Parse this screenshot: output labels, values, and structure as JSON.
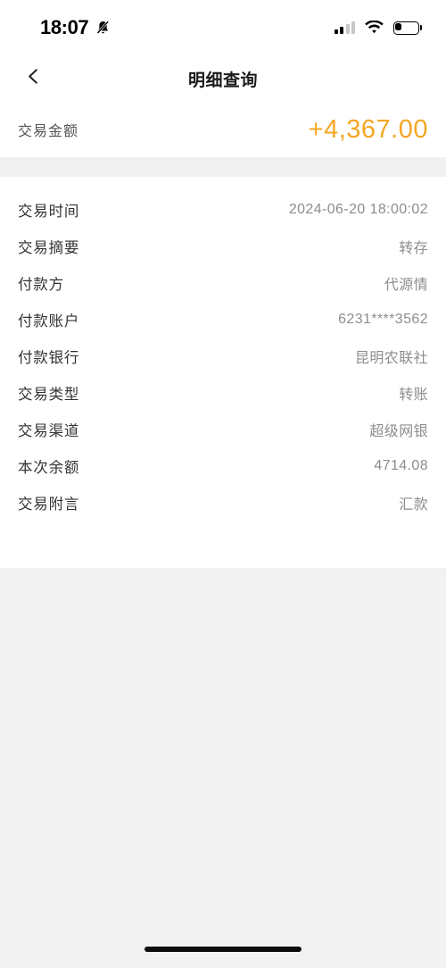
{
  "status_bar": {
    "time": "18:07",
    "icons": {
      "mute_bell": "bell-slash-icon",
      "signal": "cellular-signal-icon",
      "wifi": "wifi-icon",
      "battery": "battery-low-icon"
    }
  },
  "nav": {
    "back_icon": "chevron-left-icon",
    "title": "明细查询"
  },
  "amount": {
    "label": "交易金额",
    "value": "+4,367.00",
    "color": "#f5a623"
  },
  "details": {
    "rows": [
      {
        "label": "交易时间",
        "value": "2024-06-20 18:00:02"
      },
      {
        "label": "交易摘要",
        "value": "转存"
      },
      {
        "label": "付款方",
        "value": "代源情"
      },
      {
        "label": "付款账户",
        "value": "6231****3562"
      },
      {
        "label": "付款银行",
        "value": "昆明农联社"
      },
      {
        "label": "交易类型",
        "value": "转账"
      },
      {
        "label": "交易渠道",
        "value": "超级网银"
      },
      {
        "label": "本次余额",
        "value": "4714.08"
      },
      {
        "label": "交易附言",
        "value": "汇款"
      }
    ]
  },
  "colors": {
    "page_background": "#f2f2f2",
    "card_background": "#ffffff",
    "divider": "#f0f0f0",
    "label_text": "#333333",
    "value_text": "#8d8d8d",
    "accent": "#f5a623"
  }
}
